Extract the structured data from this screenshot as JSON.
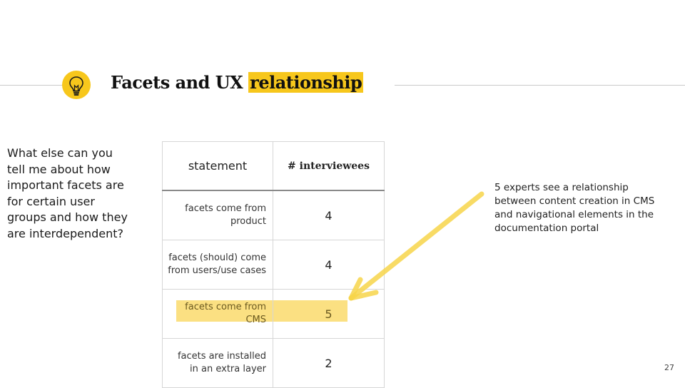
{
  "header": {
    "title_main": "Facets and UX",
    "title_highlight": "relationship"
  },
  "question": "What else can you tell me about how important facets are for certain user groups and how they are interdependent?",
  "table": {
    "headers": [
      "statement",
      "# interviewees"
    ],
    "rows": [
      {
        "statement": "facets come from product",
        "count": "4"
      },
      {
        "statement": "facets (should) come from users/use cases",
        "count": "4"
      },
      {
        "statement": "facets come from CMS",
        "count": "5"
      },
      {
        "statement": "facets are installed in an extra layer",
        "count": "2"
      }
    ]
  },
  "note": "5 experts see a relationship between content creation in CMS and navigational elements in the documentation portal",
  "page_number": "27",
  "colors": {
    "accent": "#f7c71c",
    "highlight": "#f7c71c"
  },
  "icons": {
    "title_icon": "lightbulb-icon",
    "annotation_arrow": "arrow-icon"
  }
}
